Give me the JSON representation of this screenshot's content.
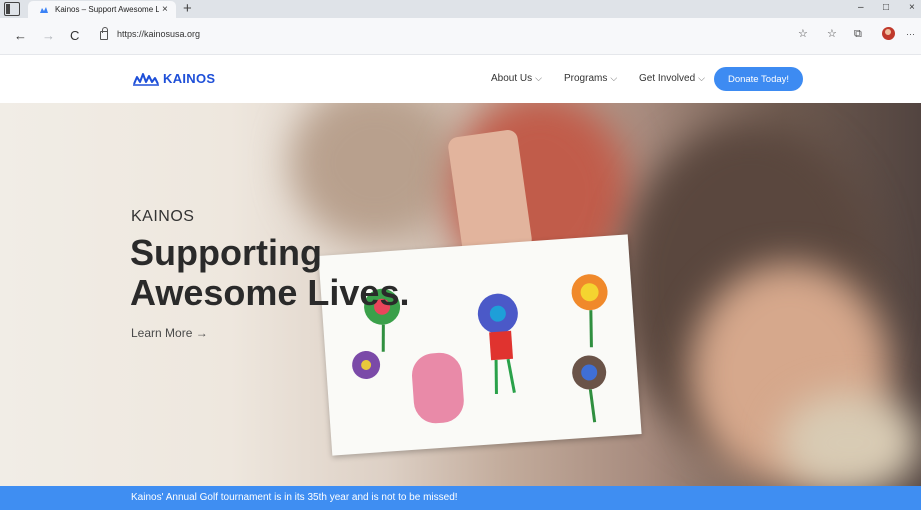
{
  "browser": {
    "tab_title": "Kainos – Support Awesome Live",
    "url": "https://kainosusa.org",
    "icons": {
      "tab_actions": "tab-actions-icon",
      "back": "←",
      "forward": "→",
      "reload": "C",
      "close_tab": "×",
      "new_tab": "+",
      "minimize": "–",
      "restore": "□",
      "close_window": "×",
      "favorite": "☆",
      "favorites": "☆",
      "collections": "⧉",
      "more": "···"
    }
  },
  "site": {
    "logo_text": "KAINOS",
    "nav": {
      "about": "About Us",
      "programs": "Programs",
      "get_involved": "Get Involved",
      "donate": "Donate Today!"
    },
    "chevron": "⌵",
    "brand_color": "#1e4fd8",
    "accent_color": "#3d8bf2"
  },
  "hero": {
    "eyebrow": "KAINOS",
    "headline_line1": "Supporting",
    "headline_line2": "Awesome Lives.",
    "learn_more": "Learn More →"
  },
  "banner": {
    "text": "Kainos' Annual Golf tournament is in its 35th year and is not to be missed!"
  }
}
